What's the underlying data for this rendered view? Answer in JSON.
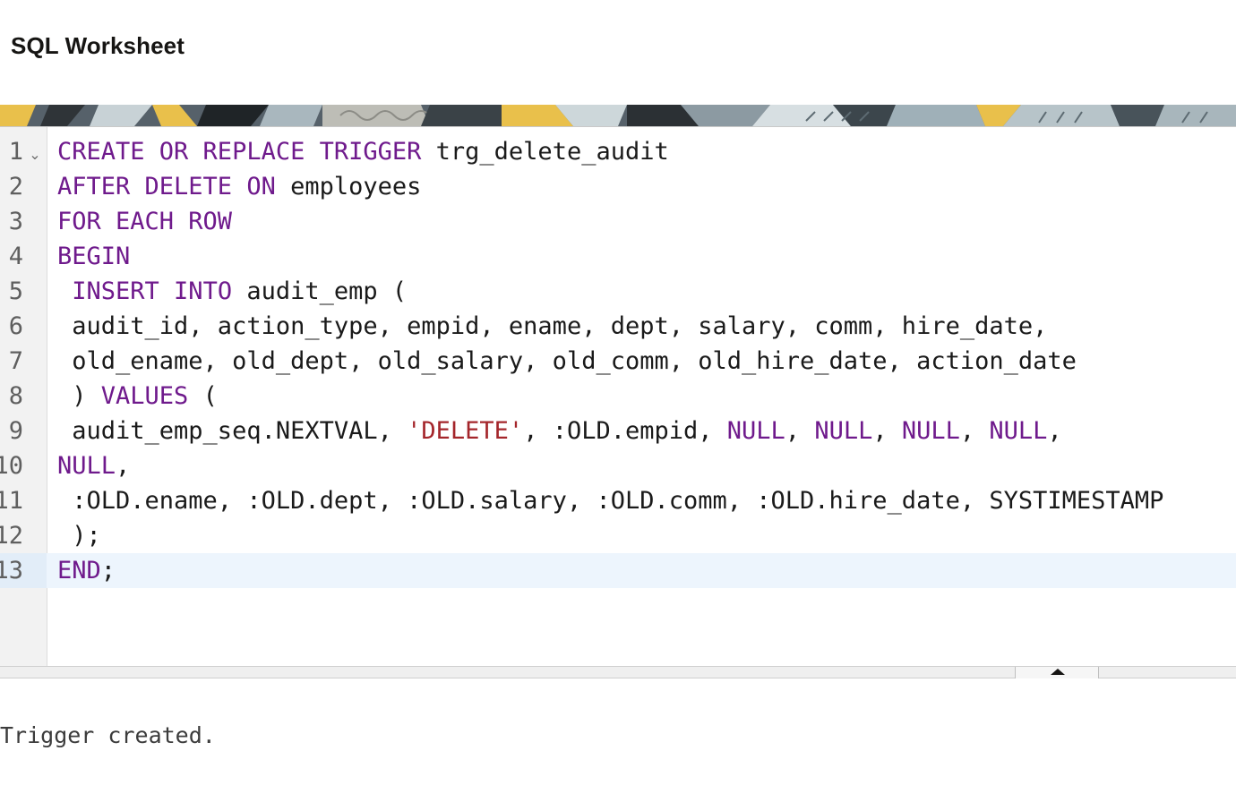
{
  "header": {
    "title": "SQL Worksheet"
  },
  "editor": {
    "active_line": 13,
    "lines": [
      {
        "num": "1",
        "segments": [
          {
            "t": "CREATE OR REPLACE TRIGGER",
            "c": "kw"
          },
          {
            "t": " trg_delete_audit",
            "c": ""
          }
        ]
      },
      {
        "num": "2",
        "segments": [
          {
            "t": "AFTER DELETE ON",
            "c": "kw"
          },
          {
            "t": " employees",
            "c": ""
          }
        ]
      },
      {
        "num": "3",
        "segments": [
          {
            "t": "FOR EACH ROW",
            "c": "kw"
          }
        ]
      },
      {
        "num": "4",
        "segments": [
          {
            "t": "BEGIN",
            "c": "kw"
          }
        ]
      },
      {
        "num": "5",
        "segments": [
          {
            "t": " ",
            "c": ""
          },
          {
            "t": "INSERT INTO",
            "c": "kw"
          },
          {
            "t": " audit_emp (",
            "c": ""
          }
        ]
      },
      {
        "num": "6",
        "segments": [
          {
            "t": " audit_id, action_type, empid, ename, dept, salary, comm, hire_date,",
            "c": ""
          }
        ]
      },
      {
        "num": "7",
        "segments": [
          {
            "t": " old_ename, old_dept, old_salary, old_comm, old_hire_date, action_date",
            "c": ""
          }
        ]
      },
      {
        "num": "8",
        "segments": [
          {
            "t": " ) ",
            "c": ""
          },
          {
            "t": "VALUES",
            "c": "kw"
          },
          {
            "t": " (",
            "c": ""
          }
        ]
      },
      {
        "num": "9",
        "segments": [
          {
            "t": " audit_emp_seq.NEXTVAL, ",
            "c": ""
          },
          {
            "t": "'DELETE'",
            "c": "str"
          },
          {
            "t": ", :OLD.empid, ",
            "c": ""
          },
          {
            "t": "NULL",
            "c": "kw"
          },
          {
            "t": ", ",
            "c": ""
          },
          {
            "t": "NULL",
            "c": "kw"
          },
          {
            "t": ", ",
            "c": ""
          },
          {
            "t": "NULL",
            "c": "kw"
          },
          {
            "t": ", ",
            "c": ""
          },
          {
            "t": "NULL",
            "c": "kw"
          },
          {
            "t": ",",
            "c": ""
          }
        ]
      },
      {
        "num": "10",
        "segments": [
          {
            "t": "NULL",
            "c": "kw"
          },
          {
            "t": ",",
            "c": ""
          }
        ]
      },
      {
        "num": "11",
        "segments": [
          {
            "t": " :OLD.ename, :OLD.dept, :OLD.salary, :OLD.comm, :OLD.hire_date, SYSTIMESTAMP",
            "c": ""
          }
        ]
      },
      {
        "num": "12",
        "segments": [
          {
            "t": " );",
            "c": ""
          }
        ]
      },
      {
        "num": "13",
        "segments": [
          {
            "t": "END",
            "c": "kw"
          },
          {
            "t": ";",
            "c": ""
          }
        ]
      }
    ]
  },
  "output": {
    "message": "Trigger created."
  },
  "colors": {
    "keyword": "#6f1a8c",
    "string": "#a4262b",
    "text": "#1a1a1a",
    "active_line": "#edf5fd"
  },
  "icons": {
    "fold": "chevron-down-icon",
    "splitter": "caret-up-icon"
  }
}
